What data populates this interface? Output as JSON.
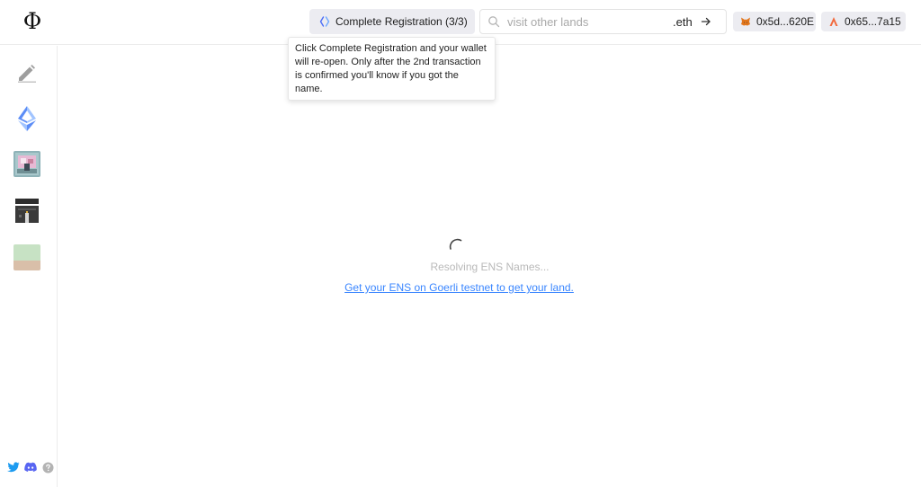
{
  "app": {
    "logo_glyph": "Φ"
  },
  "header": {
    "registration_button": {
      "label": "Complete Registration (3/3)",
      "icon": "ens-icon"
    },
    "search": {
      "placeholder": "visit other lands",
      "value": "",
      "suffix": ".eth",
      "icon": "search-icon",
      "submit_icon": "arrow-right-icon"
    },
    "wallets": [
      {
        "label": "0x5d...620E",
        "icon": "metamask-icon"
      },
      {
        "label": "0x65...7a15",
        "icon": "arbitrum-icon"
      }
    ]
  },
  "tooltip": {
    "text": "Click Complete Registration and your wallet will re-open. Only after the 2nd transaction is confirmed you'll know if you got the name."
  },
  "sidebar": {
    "items": [
      {
        "name": "edit",
        "icon": "pencil-icon"
      },
      {
        "name": "ens",
        "icon": "ens-icon"
      },
      {
        "name": "land-1",
        "icon": "land-thumbnail-icon"
      },
      {
        "name": "land-2",
        "icon": "building-icon"
      },
      {
        "name": "land-3",
        "icon": "land-tile-icon"
      }
    ],
    "socials": [
      "twitter-icon",
      "discord-icon",
      "help-icon"
    ]
  },
  "main": {
    "status_text": "Resolving ENS Names...",
    "link_text": "Get your ENS on Goerli testnet to get your land."
  },
  "colors": {
    "link": "#3a86ff",
    "status_text": "#b9b9b9",
    "button_bg": "#ececf1",
    "twitter": "#1d9bf0",
    "discord": "#5865f2"
  }
}
